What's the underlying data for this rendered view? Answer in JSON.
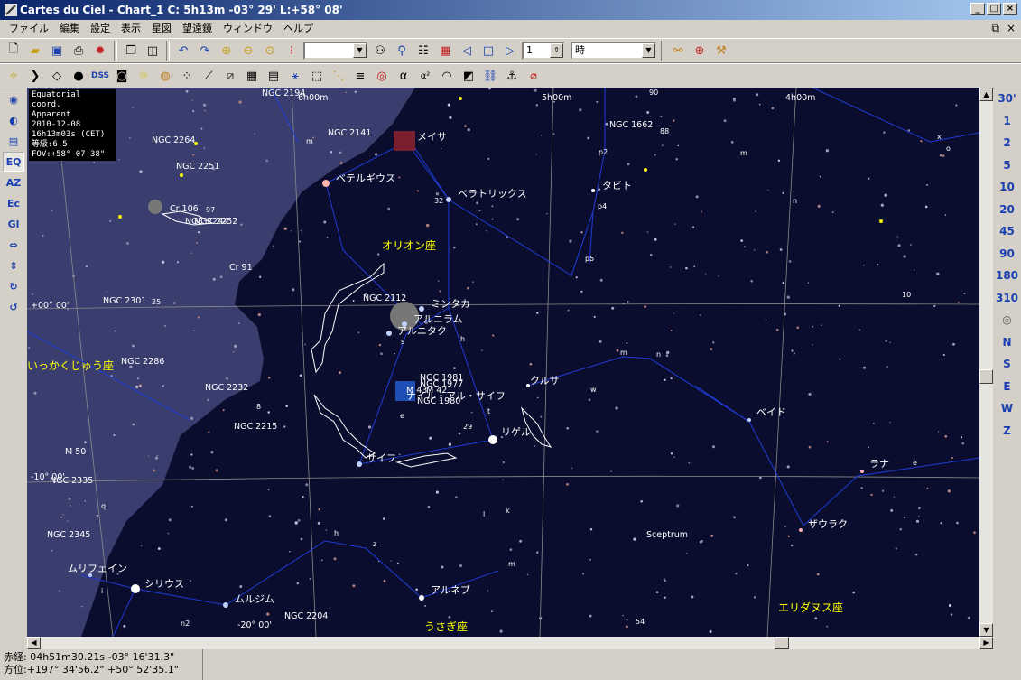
{
  "window": {
    "title": "Cartes du Ciel - Chart_1  C:  5h13m -03° 29' L:+58° 08'",
    "minimize": "_",
    "maximize": "□",
    "close": "×"
  },
  "menu": [
    "ファイル",
    "編集",
    "設定",
    "表示",
    "星図",
    "望遠鏡",
    "ウィンドウ",
    "ヘルプ"
  ],
  "toolbar": {
    "combo_empty": "",
    "field_value": "1",
    "time_unit": "時"
  },
  "toolbar2": {
    "dss_label": "DSS",
    "alpha_label": "α",
    "alpha2_label": "α²"
  },
  "left_buttons": [
    "EQ",
    "AZ",
    "Ec",
    "Gl"
  ],
  "fov_buttons": [
    "30'",
    "1",
    "2",
    "5",
    "10",
    "20",
    "45",
    "90",
    "180",
    "310"
  ],
  "direction_buttons": [
    "N",
    "S",
    "E",
    "W",
    "Z"
  ],
  "info": {
    "lines": [
      "Equatorial coord.",
      "Apparent",
      "2010-12-08",
      "16h13m03s (CET)",
      "等級:6.5",
      "FOV:+58° 07'38\""
    ]
  },
  "chart_labels": {
    "ra_labels": [
      "6h00m",
      "5h00m",
      "4h00m"
    ],
    "dec_labels": [
      "+00° 00'",
      "-10° 00'",
      "-20° 00'"
    ],
    "constellations": [
      "オリオン座",
      "いっかくじゅう座",
      "うさぎ座",
      "エリダヌス座"
    ],
    "stars": [
      "ベテルギウス",
      "ベラトリックス",
      "メイサ",
      "ミンタカ",
      "アルニラム",
      "アルニタク",
      "ナイル・アル・サイフ",
      "クルサ",
      "リゲル",
      "サイフ",
      "タビト",
      "ベイド",
      "ラナ",
      "ザウラク",
      "シリウス",
      "ムリフェイン",
      "ムルジム",
      "アルネブ"
    ],
    "dso": [
      "NGC 2194",
      "NGC 2141",
      "NGC 2264",
      "NGC 2251",
      "Cr 106",
      "Cr 91",
      "NGC 2112",
      "NGC 2301",
      "NGC 2286",
      "NGC 2232",
      "NGC 2215",
      "M 50",
      "NGC 2335",
      "NGC 2345",
      "NGC 2204",
      "NGC 1662",
      "NGC 1981",
      "NGC 1977",
      "M 42",
      "NGC 1980",
      "M 43",
      "Sceptrum",
      "NGC 2244",
      "NGC 2252"
    ],
    "small_labels": [
      "m",
      "p2",
      "p4",
      "p5",
      "32",
      "88",
      "90",
      "10",
      "m",
      "n",
      "h",
      "s",
      "w",
      "t",
      "29",
      "m",
      "n",
      "e",
      "l",
      "k",
      "z",
      "h",
      "m",
      "54",
      "q",
      "i",
      "n2",
      "8",
      "25",
      "97",
      "x",
      "o",
      "e"
    ]
  },
  "status": {
    "line1": "赤経: 04h51m30.21s -03°  16'31.3\"",
    "line2": "方位:+197°  34'56.2\" +50°  52'35.1\""
  },
  "colors": {
    "sky": "#0b0d2e",
    "milky_way": "#3a3e6e",
    "constellation_line": "#1e3cd6",
    "grid": "#8a8a8a",
    "constellation_label": "#ffff00",
    "star_label": "#ffffff"
  }
}
